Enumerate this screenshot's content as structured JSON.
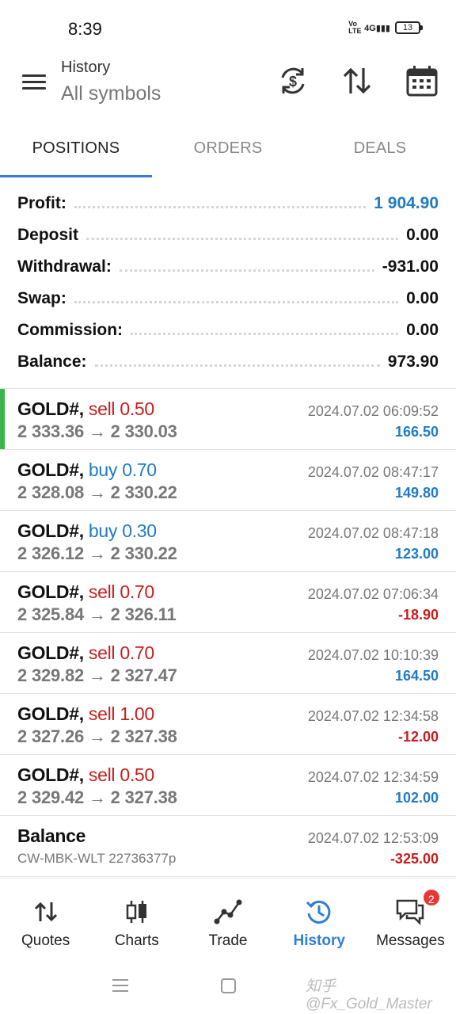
{
  "status_bar": {
    "time": "8:39",
    "network": "4G",
    "volte": "Vo LTE",
    "battery": "13"
  },
  "header": {
    "subtitle": "History",
    "title": "All symbols",
    "icons": [
      "currency-sync-icon",
      "sort-icon",
      "calendar-icon"
    ]
  },
  "tabs": [
    {
      "label": "POSITIONS",
      "active": true
    },
    {
      "label": "ORDERS",
      "active": false
    },
    {
      "label": "DEALS",
      "active": false
    }
  ],
  "summary": {
    "profit": {
      "label": "Profit:",
      "value": "1 904.90"
    },
    "deposit": {
      "label": "Deposit",
      "value": "0.00"
    },
    "withdrawal": {
      "label": "Withdrawal:",
      "value": "-931.00"
    },
    "swap": {
      "label": "Swap:",
      "value": "0.00"
    },
    "commission": {
      "label": "Commission:",
      "value": "0.00"
    },
    "balance": {
      "label": "Balance:",
      "value": "973.90"
    }
  },
  "positions": [
    {
      "symbol": "GOLD#,",
      "side": "sell",
      "volume": "0.50",
      "prices": "2 333.36 → 2 330.03",
      "time": "2024.07.02 06:09:52",
      "profit": "166.50"
    },
    {
      "symbol": "GOLD#,",
      "side": "buy",
      "volume": "0.70",
      "prices": "2 328.08 → 2 330.22",
      "time": "2024.07.02 08:47:17",
      "profit": "149.80"
    },
    {
      "symbol": "GOLD#,",
      "side": "buy",
      "volume": "0.30",
      "prices": "2 326.12 → 2 330.22",
      "time": "2024.07.02 08:47:18",
      "profit": "123.00"
    },
    {
      "symbol": "GOLD#,",
      "side": "sell",
      "volume": "0.70",
      "prices": "2 325.84 → 2 326.11",
      "time": "2024.07.02 07:06:34",
      "profit": "-18.90"
    },
    {
      "symbol": "GOLD#,",
      "side": "sell",
      "volume": "0.70",
      "prices": "2 329.82 → 2 327.47",
      "time": "2024.07.02 10:10:39",
      "profit": "164.50"
    },
    {
      "symbol": "GOLD#,",
      "side": "sell",
      "volume": "1.00",
      "prices": "2 327.26 → 2 327.38",
      "time": "2024.07.02 12:34:58",
      "profit": "-12.00"
    },
    {
      "symbol": "GOLD#,",
      "side": "sell",
      "volume": "0.50",
      "prices": "2 329.42 → 2 327.38",
      "time": "2024.07.02 12:34:59",
      "profit": "102.00"
    }
  ],
  "balance_entry": {
    "title": "Balance",
    "comment": "CW-MBK-WLT 22736377p",
    "time": "2024.07.02 12:53:09",
    "amount": "-325.00"
  },
  "bottom_nav": [
    {
      "label": "Quotes",
      "icon": "quotes-arrows-icon",
      "active": false
    },
    {
      "label": "Charts",
      "icon": "candlestick-icon",
      "active": false
    },
    {
      "label": "Trade",
      "icon": "trend-line-icon",
      "active": false
    },
    {
      "label": "History",
      "icon": "history-clock-icon",
      "active": true
    },
    {
      "label": "Messages",
      "icon": "chat-bubbles-icon",
      "active": false,
      "badge": "2"
    }
  ],
  "watermark": "知乎 @Fx_Gold_Master",
  "colors": {
    "accent_blue": "#1f7bc4",
    "sell_red": "#c81d1d",
    "tab_indicator": "#3a7bd5",
    "position_marker_green": "#3cb54a",
    "badge_red": "#e53935"
  }
}
